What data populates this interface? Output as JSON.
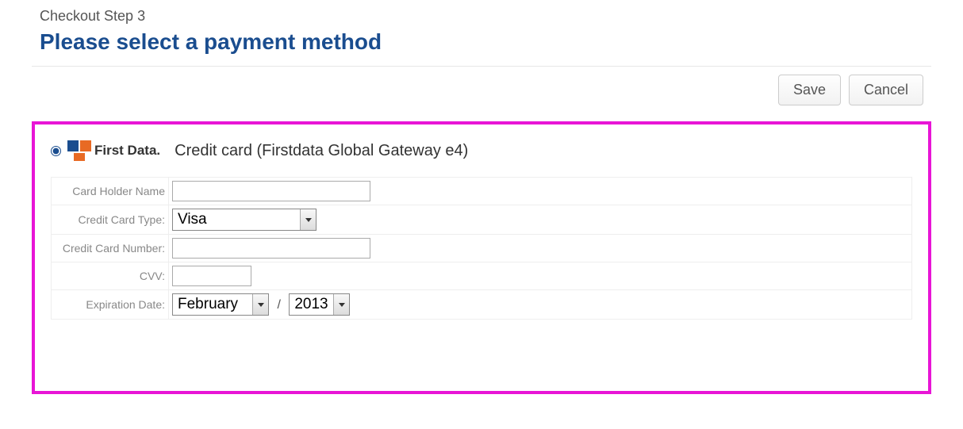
{
  "header": {
    "step_label": "Checkout Step 3",
    "title": "Please select a payment method"
  },
  "actions": {
    "save_label": "Save",
    "cancel_label": "Cancel"
  },
  "payment": {
    "logo_text": "First Data.",
    "option_label": "Credit card (Firstdata Global Gateway e4)"
  },
  "form": {
    "card_holder_label": "Card Holder Name",
    "card_holder_value": "",
    "card_type_label": "Credit Card Type:",
    "card_type_value": "Visa",
    "card_number_label": "Credit Card Number:",
    "card_number_value": "",
    "cvv_label": "CVV:",
    "cvv_value": "",
    "expiration_label": "Expiration Date:",
    "expiration_month": "February",
    "expiration_separator": "/",
    "expiration_year": "2013"
  }
}
